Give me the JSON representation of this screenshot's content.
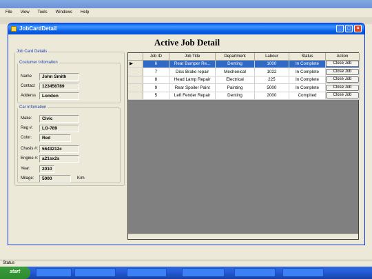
{
  "window": {
    "title": "JobCardDetail"
  },
  "page_title": "Active Job Detail",
  "job_card": {
    "legend": "Job Card Details",
    "customer": {
      "legend": "Costumer Infomation",
      "fields": [
        {
          "label": "Name",
          "value": "John Smith"
        },
        {
          "label": "Contact",
          "value": "123456789"
        },
        {
          "label": "Adderss",
          "value": "London"
        }
      ]
    },
    "car": {
      "legend": "Car Infomation",
      "fields": [
        {
          "label": "Make:",
          "value": "Civic"
        },
        {
          "label": "Reg #:",
          "value": "LO-789"
        },
        {
          "label": "Color:",
          "value": "Red"
        },
        {
          "label": "Chasis #:",
          "value": "5643212c"
        },
        {
          "label": "Engine #:",
          "value": "a21sx2s"
        },
        {
          "label": "Year:",
          "value": "2010"
        },
        {
          "label": "Milage:",
          "value": "5000",
          "unit": "K/m"
        }
      ]
    }
  },
  "grid": {
    "columns": [
      "Job ID",
      "Job Title",
      "Department",
      "Labour",
      "Status",
      "Action"
    ],
    "rows": [
      {
        "id": "6",
        "title": "Rear Bumper Re...",
        "dept": "Denting",
        "labour": "1000",
        "status": "In Complete",
        "action": "Close Job",
        "selected": true
      },
      {
        "id": "7",
        "title": "Disc Brake repair",
        "dept": "Mechenical",
        "labour": "1022",
        "status": "In Complete",
        "action": "Close Job"
      },
      {
        "id": "8",
        "title": "Head Lamp Repair",
        "dept": "Electrical",
        "labour": "225",
        "status": "In Complete",
        "action": "Close Job"
      },
      {
        "id": "9",
        "title": "Rear Spoiler Paint",
        "dept": "Painting",
        "labour": "5000",
        "status": "In Complete",
        "action": "Close Job"
      },
      {
        "id": "5",
        "title": "Left Fender Repair",
        "dept": "Denting",
        "labour": "2000",
        "status": "Complted",
        "action": "Close Job"
      }
    ]
  },
  "parent": {
    "menu": [
      "File",
      "View",
      "Tools",
      "Windows",
      "Help"
    ],
    "statusbar": "Status"
  },
  "taskbar": {
    "start": "start"
  }
}
